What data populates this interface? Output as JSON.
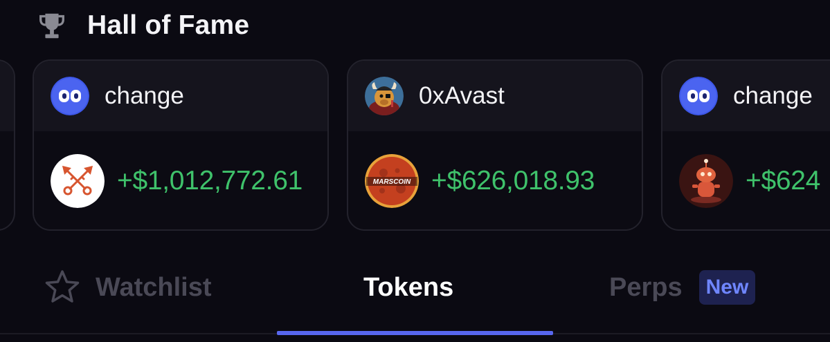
{
  "header": {
    "title": "Hall of Fame",
    "icon": "trophy-icon"
  },
  "cards": [
    {
      "trader": "",
      "pnl": ""
    },
    {
      "trader": "change",
      "avatar_icon": "change-logo-icon",
      "token_icon": "crossed-keys-icon",
      "pnl": "+$1,012,772.61"
    },
    {
      "trader": "0xAvast",
      "avatar_icon": "pirate-bull-avatar-icon",
      "token_icon": "marscoin-icon",
      "token_label": "MARSCOIN",
      "pnl": "+$626,018.93"
    },
    {
      "trader": "change",
      "avatar_icon": "change-logo-icon",
      "token_icon": "robot-mascot-icon",
      "pnl": "+$624"
    }
  ],
  "tabs": [
    {
      "label": "Watchlist",
      "icon": "star-icon",
      "active": false
    },
    {
      "label": "Tokens",
      "active": true
    },
    {
      "label": "Perps",
      "badge": "New",
      "active": false
    }
  ],
  "colors": {
    "background": "#0b0a12",
    "card_header": "#15141d",
    "profit_green": "#3fc26b",
    "accent_blue": "#5867ef",
    "badge_bg": "#1e2250",
    "badge_text": "#6f86ff",
    "inactive_tab": "#4a4956"
  }
}
